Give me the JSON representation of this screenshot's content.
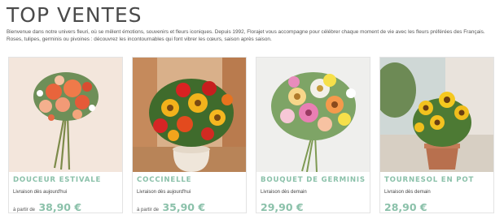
{
  "page": {
    "title": "TOP VENTES",
    "intro": "Bienvenue dans notre univers fleuri, où se mêlent émotions, souvenirs et fleurs iconiques. Depuis 1992, Florajet vous accompagne pour célébrer chaque moment de vie avec les fleurs préférées des Français. Roses, tulipes, germinis ou pivoines : découvrez les incontournables qui font vibrer les cœurs, saison après saison."
  },
  "colors": {
    "accent": "#8bc1aa"
  },
  "products": [
    {
      "name": "DOUCEUR ESTIVALE",
      "delivery": "Livraison dès aujourd'hui",
      "price_prefix": "à partir de",
      "price": "38,90 €"
    },
    {
      "name": "COCCINELLE",
      "delivery": "Livraison dès aujourd'hui",
      "price_prefix": "à partir de",
      "price": "35,90 €"
    },
    {
      "name": "BOUQUET DE GERMINIS",
      "delivery": "Livraison dès demain",
      "price_prefix": "",
      "price": "29,90 €"
    },
    {
      "name": "TOURNESOL EN POT",
      "delivery": "Livraison dès demain",
      "price_prefix": "",
      "price": "28,90 €"
    }
  ]
}
